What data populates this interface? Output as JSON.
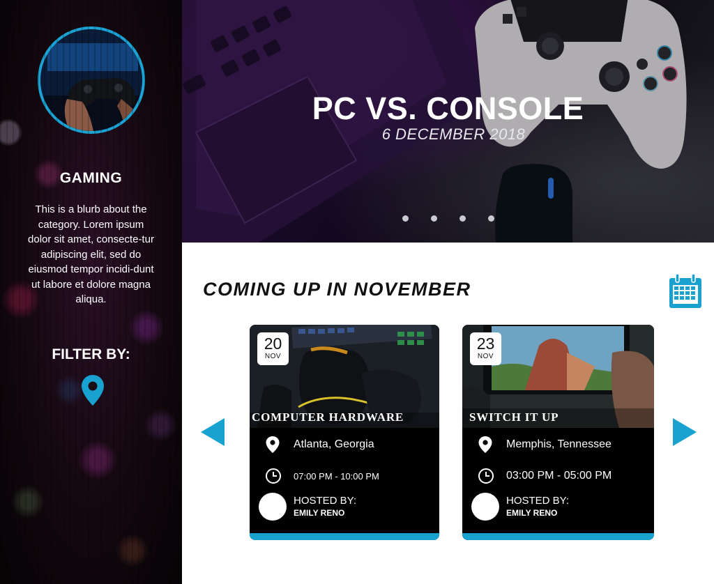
{
  "theme": {
    "accent": "#19a1cf",
    "sidebar_bg": "#14080f",
    "card_bg": "#000000"
  },
  "sidebar": {
    "avatar_icon": "gaming-controller-photo",
    "category_title": "GAMING",
    "category_blurb": "This is a blurb about the category. Lorem ipsum dolor sit amet, consecte-tur adipiscing elit, sed do eiusmod tempor incidi-dunt ut labore et dolore magna aliqua.",
    "filter_title": "FILTER BY:",
    "filter_icon": "location-pin-icon"
  },
  "hero": {
    "title": "PC VS. CONSOLE",
    "date": "6 DECEMBER 2018",
    "dots_count": 4
  },
  "events": {
    "section_title": "COMING UP IN NOVEMBER",
    "calendar_icon": "calendar-icon",
    "cards": [
      {
        "day": "20",
        "month": "NOV",
        "title": "COMPUTER HARDWARE",
        "location": "Atlanta, Georgia",
        "time": "07:00 PM - 10:00 PM",
        "hosted_label": "HOSTED BY:",
        "host": "EMILY RENO"
      },
      {
        "day": "23",
        "month": "NOV",
        "title": "SWITCH IT UP",
        "location": "Memphis, Tennessee",
        "time": "03:00 PM - 05:00 PM",
        "hosted_label": "HOSTED BY:",
        "host": "EMILY RENO"
      }
    ]
  }
}
